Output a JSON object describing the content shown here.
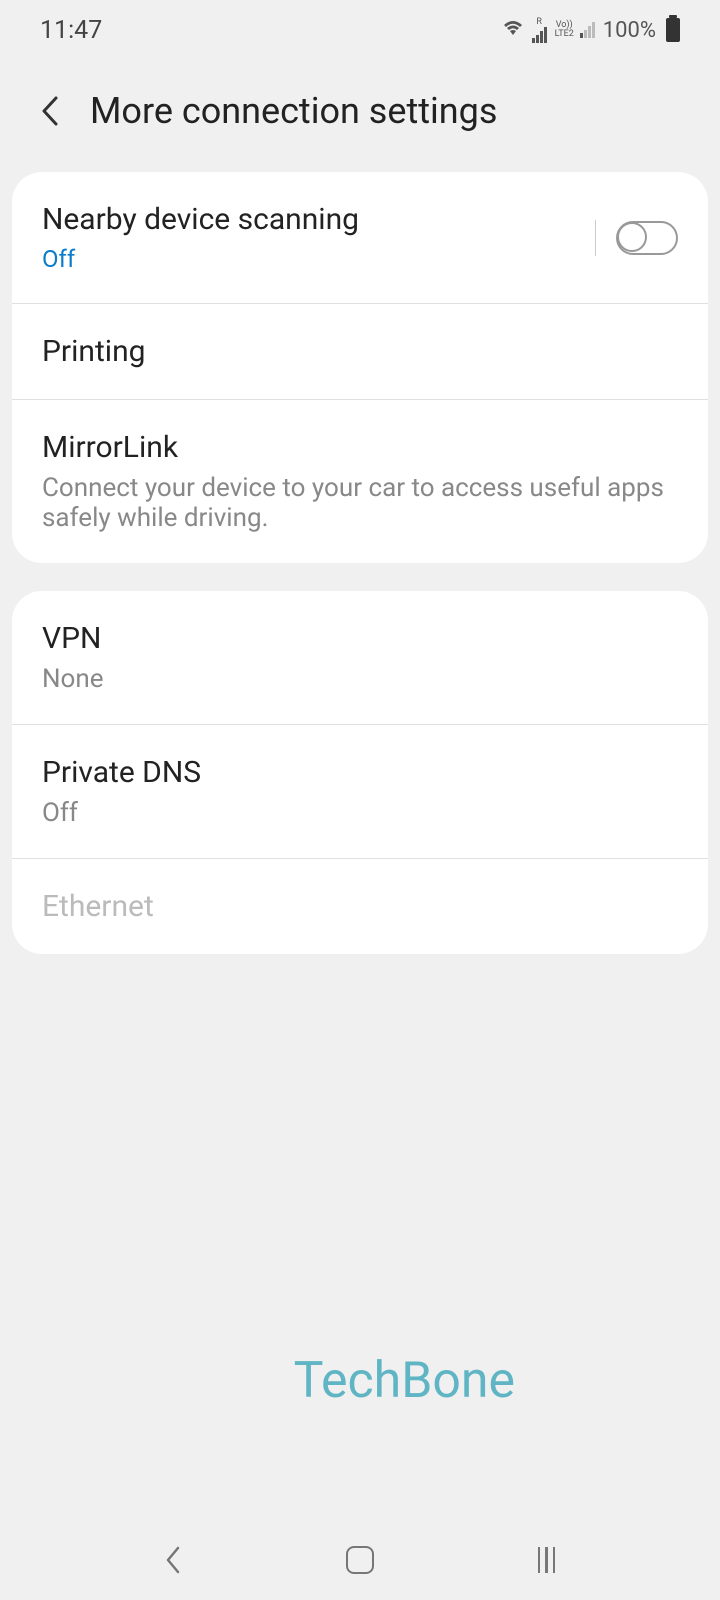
{
  "statusBar": {
    "time": "11:47",
    "battery": "100%",
    "networkLabel1": "R",
    "networkLabel2": "Vo))",
    "networkLabel3": "LTE2"
  },
  "header": {
    "title": "More connection settings"
  },
  "group1": {
    "items": [
      {
        "title": "Nearby device scanning",
        "subtitle": "Off",
        "subtitleColor": "blue",
        "hasToggle": true
      },
      {
        "title": "Printing"
      },
      {
        "title": "MirrorLink",
        "subtitle": "Connect your device to your car to access useful apps safely while driving."
      }
    ]
  },
  "group2": {
    "items": [
      {
        "title": "VPN",
        "subtitle": "None"
      },
      {
        "title": "Private DNS",
        "subtitle": "Off"
      },
      {
        "title": "Ethernet",
        "disabled": true
      }
    ]
  },
  "watermark": "TechBone"
}
